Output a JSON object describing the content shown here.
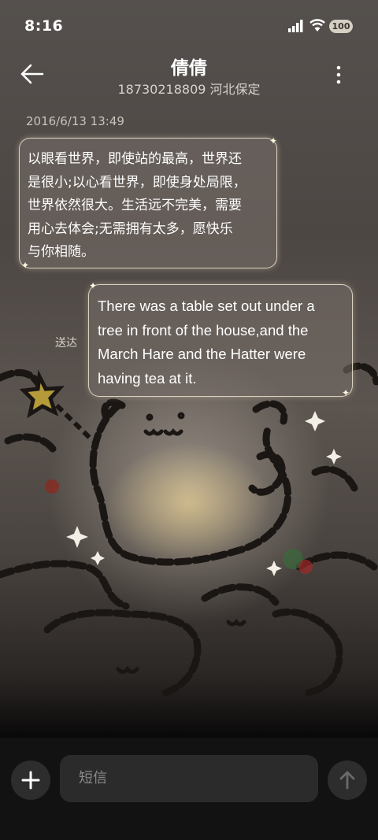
{
  "status_bar": {
    "time": "8:16",
    "battery": "100"
  },
  "header": {
    "contact_name": "倩倩",
    "contact_detail": "18730218809 河北保定"
  },
  "messages": {
    "timestamp": "2016/6/13 13:49",
    "incoming": {
      "lines": [
        "以眼看世界，即使站的最高，世界还",
        "是很小;以心看世界，即使身处局限，",
        "世界依然很大。生活远不完美，需要",
        "用心去体会;无需拥有太多，愿快乐",
        "与你相随。"
      ]
    },
    "outgoing": {
      "lines": [
        "There was a table set out under a",
        "tree in front of the house,and the",
        "March Hare and the Hatter were",
        "having tea at it."
      ],
      "status": "送达"
    }
  },
  "composer": {
    "placeholder": "短信"
  },
  "icons": {
    "back": "back-arrow-icon",
    "more": "more-vertical-icon",
    "add": "plus-icon",
    "send": "arrow-up-icon",
    "signal": "signal-icon",
    "wifi": "wifi-icon"
  },
  "colors": {
    "bubble_border": "#e8decd",
    "input_bar": "#121212",
    "background": "#4a4440"
  }
}
